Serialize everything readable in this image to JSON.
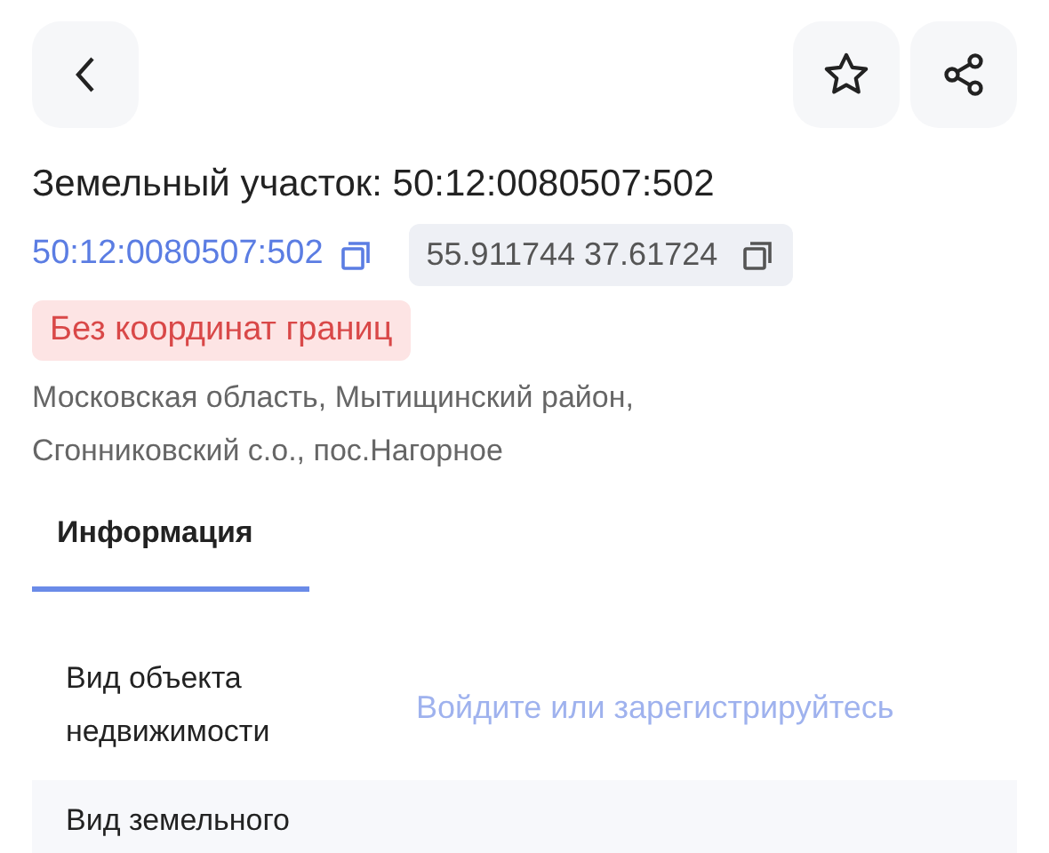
{
  "title": "Земельный участок: 50:12:0080507:502",
  "cadastral_number": "50:12:0080507:502",
  "coordinates": "55.911744 37.61724",
  "status_badge": "Без координат границ",
  "address": "Московская область, Мытищинский район, Сгонниковский с.о., пос.Нагорное",
  "tabs": [
    {
      "label": "Информация",
      "selected": true
    }
  ],
  "rows": [
    {
      "label": "Вид объекта недвижимости",
      "value": "Войдите или зарегистрируйтесь"
    },
    {
      "label": "Вид земельного"
    }
  ]
}
